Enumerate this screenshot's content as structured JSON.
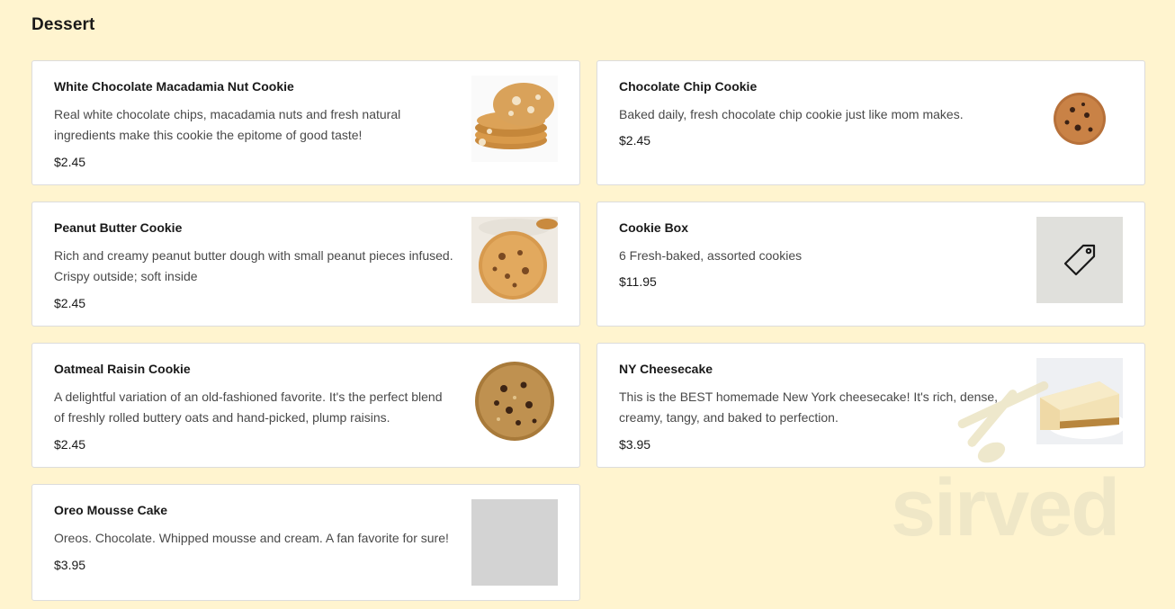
{
  "section": {
    "title": "Dessert"
  },
  "items": [
    {
      "name": "White Chocolate Macadamia Nut Cookie",
      "description": "Real white chocolate chips, macadamia nuts and fresh natural ingredients make this cookie the epitome of good taste!",
      "price": "$2.45",
      "image": "cookie-stack-photo"
    },
    {
      "name": "Chocolate Chip Cookie",
      "description": "Baked daily, fresh chocolate chip cookie just like mom makes.",
      "price": "$2.45",
      "image": "chocolate-chip-cookie-photo"
    },
    {
      "name": "Peanut Butter Cookie",
      "description": "Rich and creamy peanut butter dough with small peanut pieces infused. Crispy outside; soft inside",
      "price": "$2.45",
      "image": "peanut-butter-cookie-photo"
    },
    {
      "name": "Cookie Box",
      "description": "6 Fresh-baked, assorted cookies",
      "price": "$11.95",
      "image": "tag-icon"
    },
    {
      "name": "Oatmeal Raisin Cookie",
      "description": "A delightful variation of an old-fashioned favorite. It's the perfect blend of freshly rolled buttery oats and hand-picked, plump raisins. Deliciously...",
      "price": "$2.45",
      "image": "oatmeal-raisin-cookie-photo"
    },
    {
      "name": "NY Cheesecake",
      "description": "This is the BEST homemade New York cheesecake! It's rich, dense, creamy, tangy, and baked to perfection.",
      "price": "$3.95",
      "image": "cheesecake-photo"
    },
    {
      "name": "Oreo Mousse Cake",
      "description": "Oreos. Chocolate. Whipped mousse and cream. A fan favorite for sure!",
      "price": "$3.95",
      "image": "image-placeholder"
    }
  ],
  "watermark": {
    "text": "sirved"
  },
  "colors": {
    "page_background": "#fff4cf",
    "card_background": "#ffffff",
    "card_border": "#dcdcdc",
    "text_primary": "#191919",
    "text_secondary": "#494949",
    "placeholder_gray": "#d3d3d3"
  }
}
